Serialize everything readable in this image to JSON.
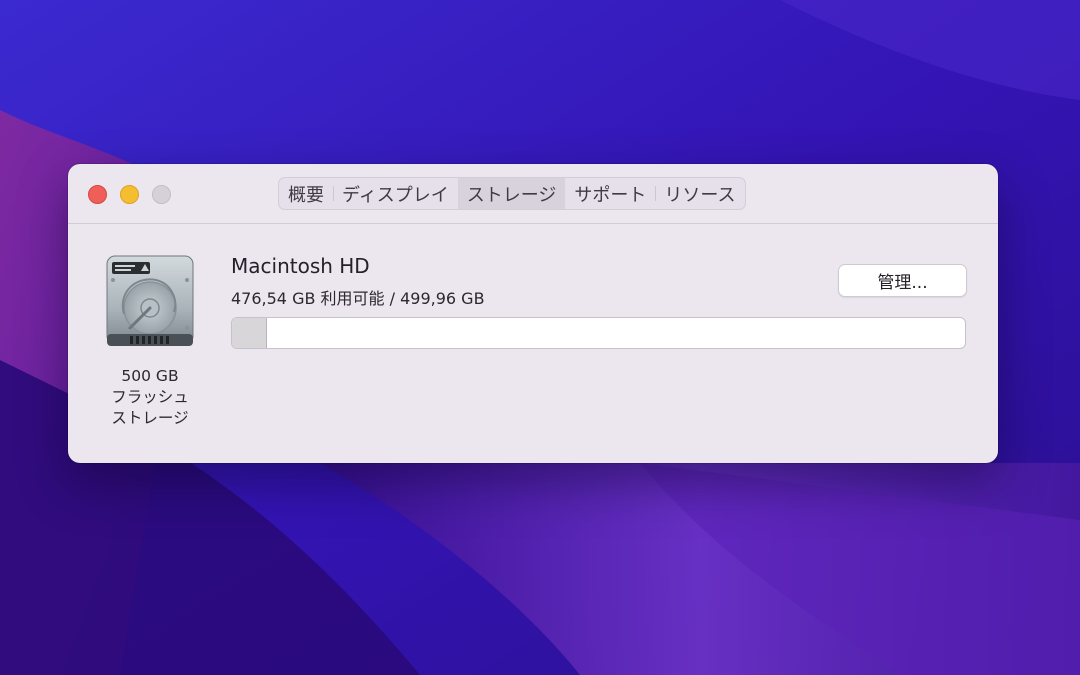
{
  "window": {
    "tabs": [
      {
        "label": "概要",
        "active": false
      },
      {
        "label": "ディスプレイ",
        "active": false
      },
      {
        "label": "ストレージ",
        "active": true
      },
      {
        "label": "サポート",
        "active": false
      },
      {
        "label": "リソース",
        "active": false
      }
    ]
  },
  "storage": {
    "drive": {
      "capacity_label": "500 GB",
      "type_line1": "フラッシュ",
      "type_line2": "ストレージ"
    },
    "volume": {
      "name": "Macintosh HD",
      "capacity_text": "476,54 GB 利用可能 / 499,96 GB",
      "available_gb": 476.54,
      "total_gb": 499.96,
      "used_fraction": 0.047
    },
    "manage_label": "管理..."
  },
  "colors": {
    "window_bg": "#ece6ef",
    "close": "#ed5f57",
    "minimize": "#f5be30",
    "zoom_inactive": "#d6d1d9",
    "bar_used": "#d9d6da"
  }
}
